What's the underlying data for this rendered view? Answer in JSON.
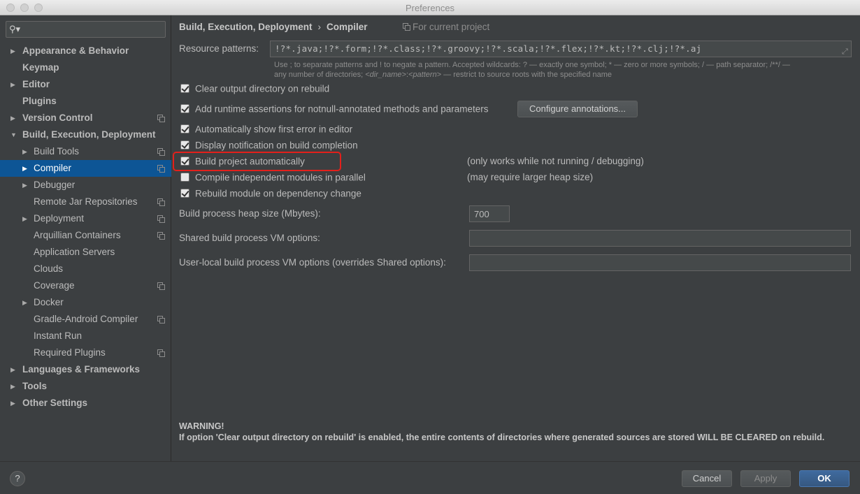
{
  "window": {
    "title": "Preferences"
  },
  "search": {
    "placeholder": "",
    "value": ""
  },
  "sidebar": {
    "items": [
      {
        "label": "Appearance & Behavior"
      },
      {
        "label": "Keymap"
      },
      {
        "label": "Editor"
      },
      {
        "label": "Plugins"
      },
      {
        "label": "Version Control"
      },
      {
        "label": "Build, Execution, Deployment"
      },
      {
        "label": "Build Tools"
      },
      {
        "label": "Compiler"
      },
      {
        "label": "Debugger"
      },
      {
        "label": "Remote Jar Repositories"
      },
      {
        "label": "Deployment"
      },
      {
        "label": "Arquillian Containers"
      },
      {
        "label": "Application Servers"
      },
      {
        "label": "Clouds"
      },
      {
        "label": "Coverage"
      },
      {
        "label": "Docker"
      },
      {
        "label": "Gradle-Android Compiler"
      },
      {
        "label": "Instant Run"
      },
      {
        "label": "Required Plugins"
      },
      {
        "label": "Languages & Frameworks"
      },
      {
        "label": "Tools"
      },
      {
        "label": "Other Settings"
      }
    ]
  },
  "header": {
    "crumb1": "Build, Execution, Deployment",
    "crumb_sep": "›",
    "crumb2": "Compiler",
    "scope": "For current project"
  },
  "compiler": {
    "resource_label": "Resource patterns:",
    "resource_value": "!?*.java;!?*.form;!?*.class;!?*.groovy;!?*.scala;!?*.flex;!?*.kt;!?*.clj;!?*.aj",
    "hint_line1": "Use ; to separate patterns and ! to negate a pattern. Accepted wildcards: ? — exactly one symbol; * — zero or more symbols; / — path separator; /**/ —",
    "hint_line2_a": "any number of directories; ",
    "hint_line2_b": "<dir_name>",
    "hint_line2_c": ":",
    "hint_line2_d": "<pattern>",
    "hint_line2_e": " — restrict to source roots with the specified name",
    "options": [
      {
        "label": "Clear output directory on rebuild",
        "checked": true
      },
      {
        "label": "Add runtime assertions for notnull-annotated methods and parameters",
        "checked": true
      },
      {
        "label": "Automatically show first error in editor",
        "checked": true
      },
      {
        "label": "Display notification on build completion",
        "checked": true
      },
      {
        "label": "Build project automatically",
        "checked": true
      },
      {
        "label": "Compile independent modules in parallel",
        "checked": false
      },
      {
        "label": "Rebuild module on dependency change",
        "checked": true
      }
    ],
    "configure_button": "Configure annotations...",
    "note_auto": "(only works while not running / debugging)",
    "note_parallel": "(may require larger heap size)",
    "heap_label": "Build process heap size (Mbytes):",
    "heap_value": "700",
    "shared_vm_label": "Shared build process VM options:",
    "shared_vm_value": "",
    "user_vm_label": "User-local build process VM options (overrides Shared options):",
    "user_vm_value": "",
    "warning_title": "WARNING!",
    "warning_text": "If option 'Clear output directory on rebuild' is enabled, the entire contents of directories where generated sources are stored WILL BE CLEARED on rebuild."
  },
  "footer": {
    "help": "?",
    "cancel": "Cancel",
    "apply": "Apply",
    "ok": "OK"
  },
  "colors": {
    "selection": "#0d5595",
    "highlight": "#e3201b",
    "ok_button": "#365880"
  }
}
